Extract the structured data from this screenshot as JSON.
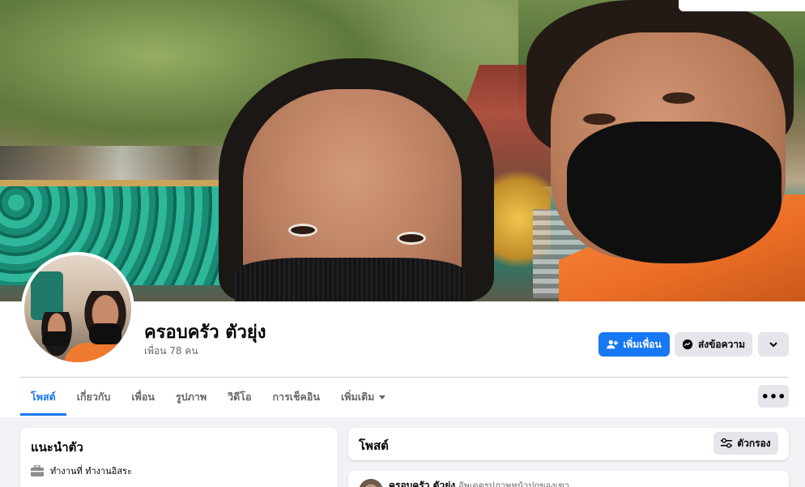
{
  "profile": {
    "name": "ครอบครัว ตัวยุ่ง",
    "friends_count": "เพื่อน 78 คน"
  },
  "actions": {
    "add_friend": "เพิ่มเพื่อน",
    "message": "ส่งข้อความ"
  },
  "tabs": [
    {
      "label": "โพสต์",
      "active": true
    },
    {
      "label": "เกี่ยวกับ",
      "active": false
    },
    {
      "label": "เพื่อน",
      "active": false
    },
    {
      "label": "รูปภาพ",
      "active": false
    },
    {
      "label": "วิดีโอ",
      "active": false
    },
    {
      "label": "การเช็คอิน",
      "active": false
    },
    {
      "label": "เพิ่มเติม",
      "active": false
    }
  ],
  "intro": {
    "title": "แนะนำตัว",
    "work": "ทำงานที่ ทำงานอิสระ"
  },
  "posts": {
    "title": "โพสต์",
    "filter": "ตัวกรอง",
    "first_post_author": "ครอบครัว ตัวยุ่ง",
    "first_post_action": "อัพเดตรูปภาพหน้าปกของเขา"
  },
  "colors": {
    "primary": "#1877f2",
    "secondary_button": "#e4e6eb",
    "background": "#f0f2f5"
  },
  "icons": [
    "add-friend-icon",
    "messenger-icon",
    "chevron-down-icon",
    "more-dots-icon",
    "briefcase-icon",
    "filter-icon",
    "caret-down-icon"
  ]
}
